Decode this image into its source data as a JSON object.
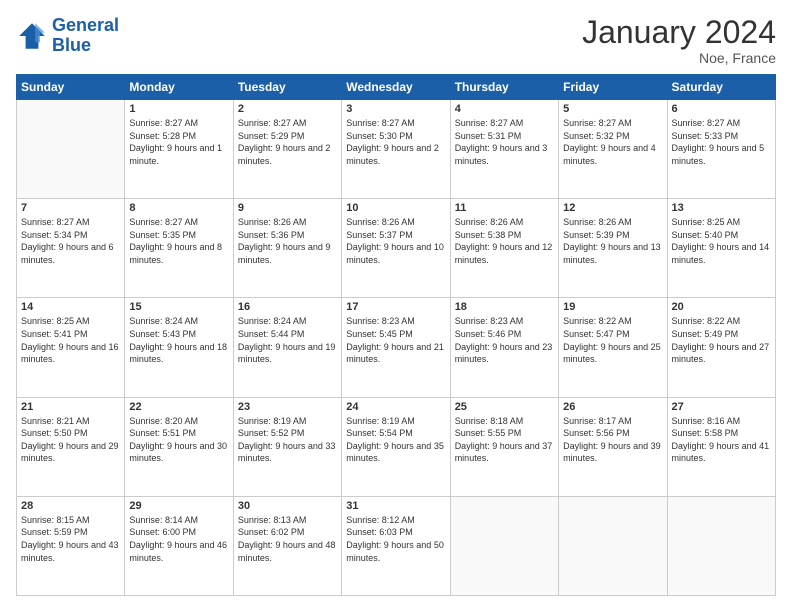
{
  "header": {
    "logo_line1": "General",
    "logo_line2": "Blue",
    "month": "January 2024",
    "location": "Noe, France"
  },
  "columns": [
    "Sunday",
    "Monday",
    "Tuesday",
    "Wednesday",
    "Thursday",
    "Friday",
    "Saturday"
  ],
  "weeks": [
    [
      {
        "day": "",
        "sunrise": "",
        "sunset": "",
        "daylight": ""
      },
      {
        "day": "1",
        "sunrise": "Sunrise: 8:27 AM",
        "sunset": "Sunset: 5:28 PM",
        "daylight": "Daylight: 9 hours and 1 minute."
      },
      {
        "day": "2",
        "sunrise": "Sunrise: 8:27 AM",
        "sunset": "Sunset: 5:29 PM",
        "daylight": "Daylight: 9 hours and 2 minutes."
      },
      {
        "day": "3",
        "sunrise": "Sunrise: 8:27 AM",
        "sunset": "Sunset: 5:30 PM",
        "daylight": "Daylight: 9 hours and 2 minutes."
      },
      {
        "day": "4",
        "sunrise": "Sunrise: 8:27 AM",
        "sunset": "Sunset: 5:31 PM",
        "daylight": "Daylight: 9 hours and 3 minutes."
      },
      {
        "day": "5",
        "sunrise": "Sunrise: 8:27 AM",
        "sunset": "Sunset: 5:32 PM",
        "daylight": "Daylight: 9 hours and 4 minutes."
      },
      {
        "day": "6",
        "sunrise": "Sunrise: 8:27 AM",
        "sunset": "Sunset: 5:33 PM",
        "daylight": "Daylight: 9 hours and 5 minutes."
      }
    ],
    [
      {
        "day": "7",
        "sunrise": "Sunrise: 8:27 AM",
        "sunset": "Sunset: 5:34 PM",
        "daylight": "Daylight: 9 hours and 6 minutes."
      },
      {
        "day": "8",
        "sunrise": "Sunrise: 8:27 AM",
        "sunset": "Sunset: 5:35 PM",
        "daylight": "Daylight: 9 hours and 8 minutes."
      },
      {
        "day": "9",
        "sunrise": "Sunrise: 8:26 AM",
        "sunset": "Sunset: 5:36 PM",
        "daylight": "Daylight: 9 hours and 9 minutes."
      },
      {
        "day": "10",
        "sunrise": "Sunrise: 8:26 AM",
        "sunset": "Sunset: 5:37 PM",
        "daylight": "Daylight: 9 hours and 10 minutes."
      },
      {
        "day": "11",
        "sunrise": "Sunrise: 8:26 AM",
        "sunset": "Sunset: 5:38 PM",
        "daylight": "Daylight: 9 hours and 12 minutes."
      },
      {
        "day": "12",
        "sunrise": "Sunrise: 8:26 AM",
        "sunset": "Sunset: 5:39 PM",
        "daylight": "Daylight: 9 hours and 13 minutes."
      },
      {
        "day": "13",
        "sunrise": "Sunrise: 8:25 AM",
        "sunset": "Sunset: 5:40 PM",
        "daylight": "Daylight: 9 hours and 14 minutes."
      }
    ],
    [
      {
        "day": "14",
        "sunrise": "Sunrise: 8:25 AM",
        "sunset": "Sunset: 5:41 PM",
        "daylight": "Daylight: 9 hours and 16 minutes."
      },
      {
        "day": "15",
        "sunrise": "Sunrise: 8:24 AM",
        "sunset": "Sunset: 5:43 PM",
        "daylight": "Daylight: 9 hours and 18 minutes."
      },
      {
        "day": "16",
        "sunrise": "Sunrise: 8:24 AM",
        "sunset": "Sunset: 5:44 PM",
        "daylight": "Daylight: 9 hours and 19 minutes."
      },
      {
        "day": "17",
        "sunrise": "Sunrise: 8:23 AM",
        "sunset": "Sunset: 5:45 PM",
        "daylight": "Daylight: 9 hours and 21 minutes."
      },
      {
        "day": "18",
        "sunrise": "Sunrise: 8:23 AM",
        "sunset": "Sunset: 5:46 PM",
        "daylight": "Daylight: 9 hours and 23 minutes."
      },
      {
        "day": "19",
        "sunrise": "Sunrise: 8:22 AM",
        "sunset": "Sunset: 5:47 PM",
        "daylight": "Daylight: 9 hours and 25 minutes."
      },
      {
        "day": "20",
        "sunrise": "Sunrise: 8:22 AM",
        "sunset": "Sunset: 5:49 PM",
        "daylight": "Daylight: 9 hours and 27 minutes."
      }
    ],
    [
      {
        "day": "21",
        "sunrise": "Sunrise: 8:21 AM",
        "sunset": "Sunset: 5:50 PM",
        "daylight": "Daylight: 9 hours and 29 minutes."
      },
      {
        "day": "22",
        "sunrise": "Sunrise: 8:20 AM",
        "sunset": "Sunset: 5:51 PM",
        "daylight": "Daylight: 9 hours and 30 minutes."
      },
      {
        "day": "23",
        "sunrise": "Sunrise: 8:19 AM",
        "sunset": "Sunset: 5:52 PM",
        "daylight": "Daylight: 9 hours and 33 minutes."
      },
      {
        "day": "24",
        "sunrise": "Sunrise: 8:19 AM",
        "sunset": "Sunset: 5:54 PM",
        "daylight": "Daylight: 9 hours and 35 minutes."
      },
      {
        "day": "25",
        "sunrise": "Sunrise: 8:18 AM",
        "sunset": "Sunset: 5:55 PM",
        "daylight": "Daylight: 9 hours and 37 minutes."
      },
      {
        "day": "26",
        "sunrise": "Sunrise: 8:17 AM",
        "sunset": "Sunset: 5:56 PM",
        "daylight": "Daylight: 9 hours and 39 minutes."
      },
      {
        "day": "27",
        "sunrise": "Sunrise: 8:16 AM",
        "sunset": "Sunset: 5:58 PM",
        "daylight": "Daylight: 9 hours and 41 minutes."
      }
    ],
    [
      {
        "day": "28",
        "sunrise": "Sunrise: 8:15 AM",
        "sunset": "Sunset: 5:59 PM",
        "daylight": "Daylight: 9 hours and 43 minutes."
      },
      {
        "day": "29",
        "sunrise": "Sunrise: 8:14 AM",
        "sunset": "Sunset: 6:00 PM",
        "daylight": "Daylight: 9 hours and 46 minutes."
      },
      {
        "day": "30",
        "sunrise": "Sunrise: 8:13 AM",
        "sunset": "Sunset: 6:02 PM",
        "daylight": "Daylight: 9 hours and 48 minutes."
      },
      {
        "day": "31",
        "sunrise": "Sunrise: 8:12 AM",
        "sunset": "Sunset: 6:03 PM",
        "daylight": "Daylight: 9 hours and 50 minutes."
      },
      {
        "day": "",
        "sunrise": "",
        "sunset": "",
        "daylight": ""
      },
      {
        "day": "",
        "sunrise": "",
        "sunset": "",
        "daylight": ""
      },
      {
        "day": "",
        "sunrise": "",
        "sunset": "",
        "daylight": ""
      }
    ]
  ]
}
